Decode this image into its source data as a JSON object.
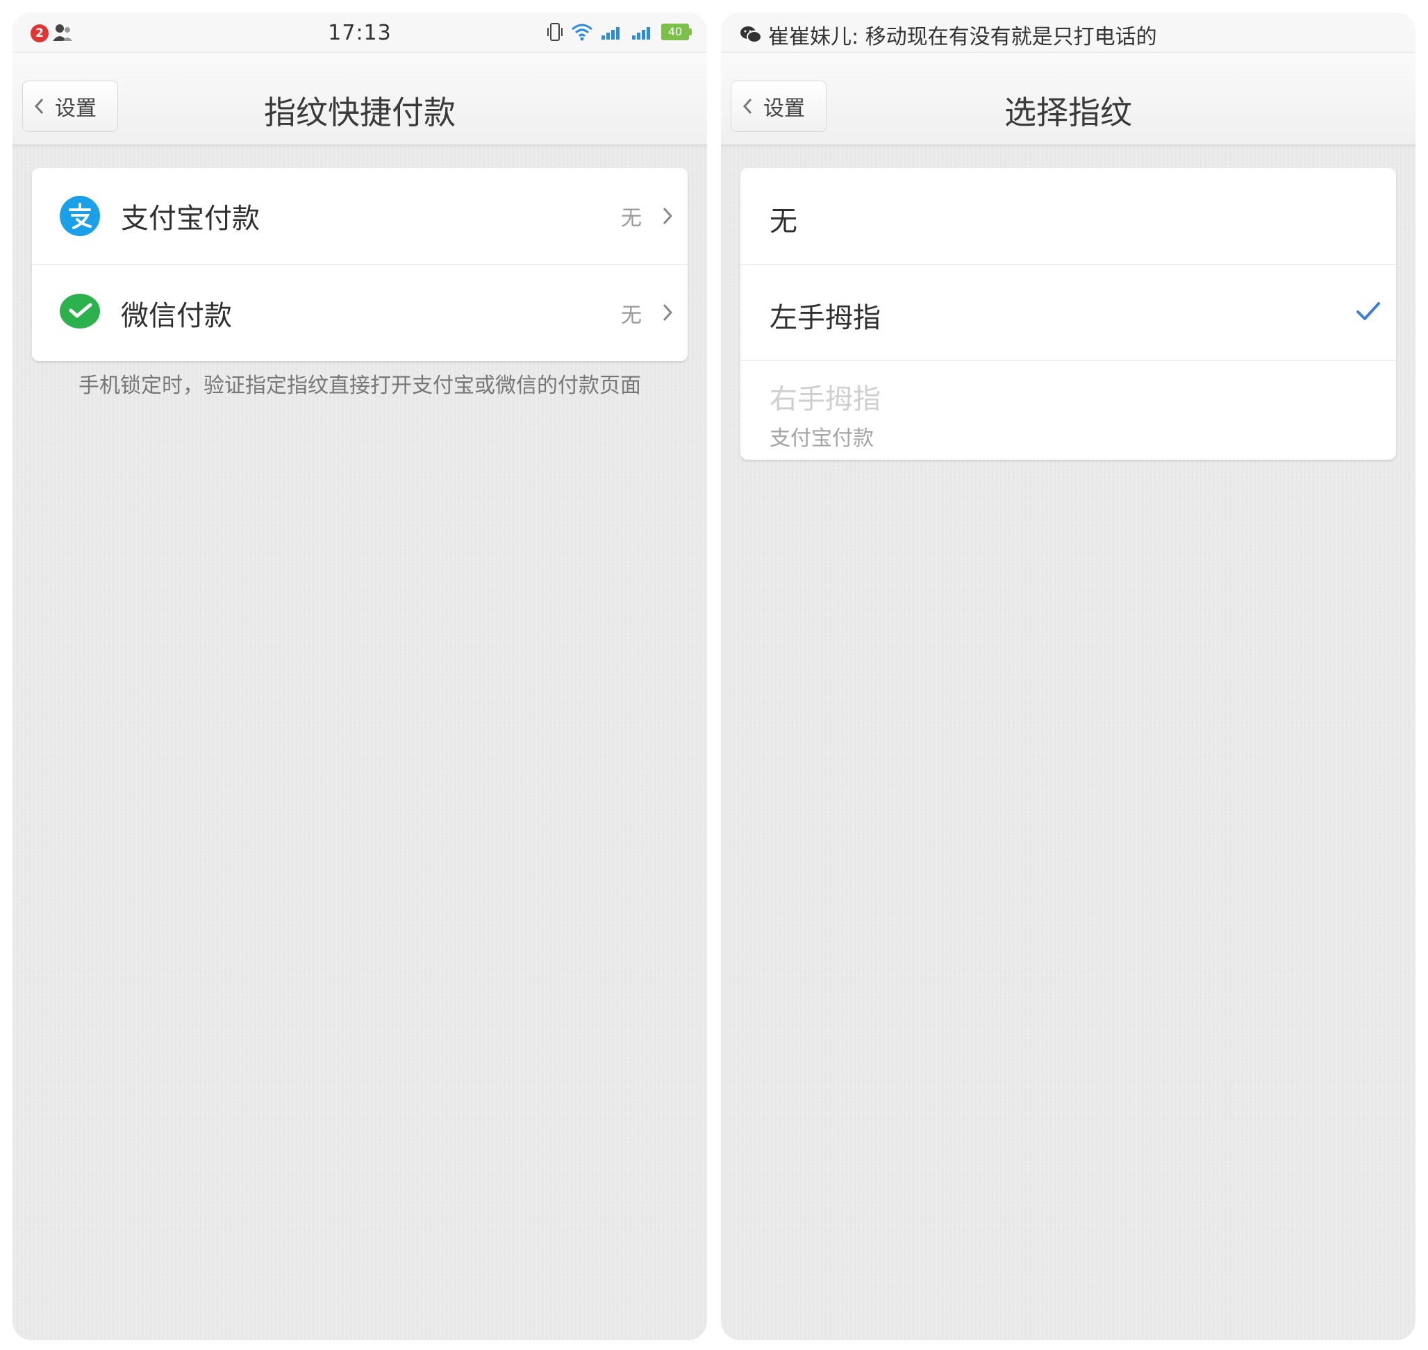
{
  "left_screen": {
    "status_bar": {
      "badge_count": "2",
      "time": "17:13",
      "battery": "40"
    },
    "nav": {
      "back_label": "设置",
      "title": "指纹快捷付款"
    },
    "items": [
      {
        "label": "支付宝付款",
        "value": "无",
        "icon": "alipay-icon"
      },
      {
        "label": "微信付款",
        "value": "无",
        "icon": "wechat-pay-icon"
      }
    ],
    "footnote": "手机锁定时，验证指定指纹直接打开支付宝或微信的付款页面"
  },
  "right_screen": {
    "notification": {
      "text": "崔崔妹儿: 移动现在有没有就是只打电话的",
      "icon": "wechat-icon"
    },
    "nav": {
      "back_label": "设置",
      "title": "选择指纹"
    },
    "options": [
      {
        "label": "无",
        "selected": false,
        "enabled": true
      },
      {
        "label": "左手拇指",
        "selected": true,
        "enabled": true
      },
      {
        "label": "右手拇指",
        "sublabel": "支付宝付款",
        "selected": false,
        "enabled": false
      }
    ]
  },
  "colors": {
    "alipay_blue": "#1aa0e8",
    "wechat_green": "#2bb24c",
    "check_blue": "#3a7ee0",
    "background": "#ebebeb"
  }
}
